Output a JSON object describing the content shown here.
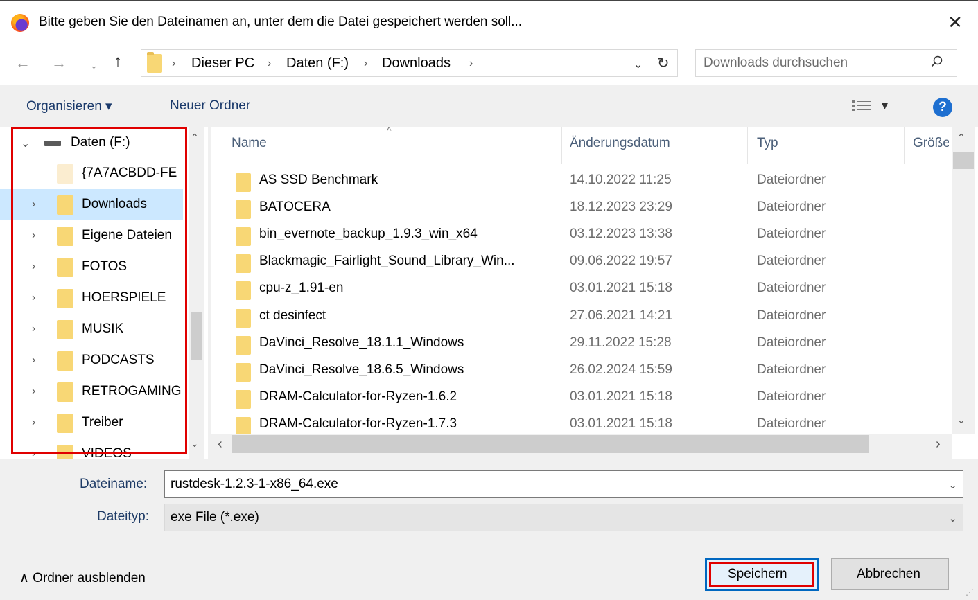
{
  "window": {
    "title": "Bitte geben Sie den Dateinamen an, unter dem die Datei gespeichert werden soll...",
    "close_glyph": "✕"
  },
  "nav": {
    "back_glyph": "←",
    "forward_glyph": "→",
    "recent_glyph": "⌄",
    "up_glyph": "↑",
    "breadcrumbs": [
      "Dieser PC",
      "Daten (F:)",
      "Downloads"
    ],
    "separator_glyph": "›",
    "dropdown_glyph": "⌄",
    "refresh_glyph": "↻",
    "search_placeholder": "Downloads durchsuchen"
  },
  "toolbar": {
    "organize_label": "Organisieren ▾",
    "new_folder_label": "Neuer Ordner",
    "view_glyph": "▾",
    "help_glyph": "?"
  },
  "navpane": {
    "items": [
      {
        "label": "Daten (F:)",
        "icon": "drive-icon",
        "expanded": true
      },
      {
        "label": "{7A7ACBDD-FE",
        "icon": "folder-icon-faded"
      },
      {
        "label": "Downloads",
        "icon": "folder-icon",
        "selected": true
      },
      {
        "label": "Eigene Dateien",
        "icon": "folder-icon"
      },
      {
        "label": "FOTOS",
        "icon": "folder-icon"
      },
      {
        "label": "HOERSPIELE",
        "icon": "folder-icon"
      },
      {
        "label": "MUSIK",
        "icon": "folder-icon"
      },
      {
        "label": "PODCASTS",
        "icon": "folder-icon"
      },
      {
        "label": "RETROGAMING",
        "icon": "folder-icon"
      },
      {
        "label": "Treiber",
        "icon": "folder-icon"
      },
      {
        "label": "VIDEOS",
        "icon": "folder-icon"
      }
    ],
    "chevron_collapsed": "›",
    "chevron_expanded": "⌄"
  },
  "filelist": {
    "columns": [
      "Name",
      "Änderungsdatum",
      "Typ",
      "Größe"
    ],
    "rows": [
      {
        "name": "AS SSD Benchmark",
        "date": "14.10.2022 11:25",
        "type": "Dateiordner"
      },
      {
        "name": "BATOCERA",
        "date": "18.12.2023 23:29",
        "type": "Dateiordner"
      },
      {
        "name": "bin_evernote_backup_1.9.3_win_x64",
        "date": "03.12.2023 13:38",
        "type": "Dateiordner"
      },
      {
        "name": "Blackmagic_Fairlight_Sound_Library_Win...",
        "date": "09.06.2022 19:57",
        "type": "Dateiordner"
      },
      {
        "name": "cpu-z_1.91-en",
        "date": "03.01.2021 15:18",
        "type": "Dateiordner"
      },
      {
        "name": "ct desinfect",
        "date": "27.06.2021 14:21",
        "type": "Dateiordner"
      },
      {
        "name": "DaVinci_Resolve_18.1.1_Windows",
        "date": "29.11.2022 15:28",
        "type": "Dateiordner"
      },
      {
        "name": "DaVinci_Resolve_18.6.5_Windows",
        "date": "26.02.2024 15:59",
        "type": "Dateiordner"
      },
      {
        "name": "DRAM-Calculator-for-Ryzen-1.6.2",
        "date": "03.01.2021 15:18",
        "type": "Dateiordner"
      },
      {
        "name": "DRAM-Calculator-for-Ryzen-1.7.3",
        "date": "03.01.2021 15:18",
        "type": "Dateiordner"
      }
    ],
    "scroll_up_glyph": "⌃",
    "scroll_down_glyph": "⌄",
    "scroll_left_glyph": "‹",
    "scroll_right_glyph": "›"
  },
  "form": {
    "filename_label": "Dateiname:",
    "filename_value": "rustdesk-1.2.3-1-x86_64.exe",
    "filetype_label": "Dateityp:",
    "filetype_value": "exe File (*.exe)",
    "chevron_glyph": "⌄"
  },
  "footer": {
    "hide_folders_label": "∧  Ordner ausblenden",
    "save_label": "Speichern",
    "cancel_label": "Abbrechen"
  },
  "colors": {
    "highlight_red": "#e00000",
    "selection_blue": "#cce8ff",
    "folder_yellow": "#f8d775",
    "help_blue": "#1e6fd0"
  }
}
